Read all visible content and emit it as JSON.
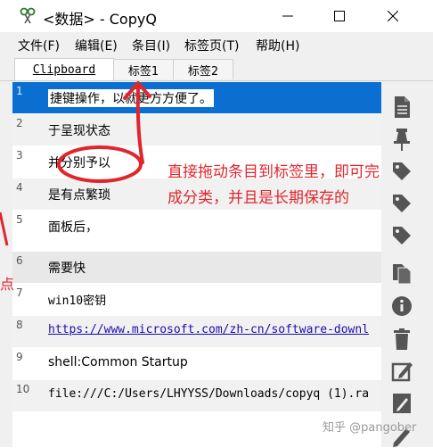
{
  "window": {
    "title": "<数据> - CopyQ"
  },
  "menu": [
    "文件(F)",
    "编辑(E)",
    "条目(I)",
    "标签页(T)",
    "帮助(H)"
  ],
  "tabs": [
    "Clipboard",
    "标签1",
    "标签2"
  ],
  "items": [
    {
      "num": "1",
      "text": "捷键操作，以就更方方便了。"
    },
    {
      "num": "2",
      "text": "于呈现状态"
    },
    {
      "num": "3",
      "text": "并分别予以"
    },
    {
      "num": "4",
      "text": "是有点繁琐"
    },
    {
      "num": "5",
      "text": "面板后，"
    },
    {
      "num": "6",
      "text": "需要快"
    },
    {
      "num": "7",
      "text": "win10密钥"
    },
    {
      "num": "8",
      "text": "https://www.microsoft.com/zh-cn/software-downl"
    },
    {
      "num": "9",
      "text": "shell:Common Startup"
    },
    {
      "num": "10",
      "text": "file:///C:/Users/LHYYSS/Downloads/copyq (1).ra"
    }
  ],
  "annotation": {
    "line1": "直接拖动条目到标签里，即可完",
    "line2": "成分类，并且是长期保存的"
  },
  "left_mark": "点",
  "watermark": "知乎 @pangober",
  "colors": {
    "selection": "#0a6fd1",
    "annotation": "#e0262c"
  },
  "sidebar_icons": [
    "document-icon",
    "pin-icon",
    "tag-icon",
    "tag-icon",
    "tag-icon",
    "copy-icon",
    "info-icon",
    "trash-icon",
    "edit-icon",
    "pencil-icon",
    "pencil-icon"
  ]
}
